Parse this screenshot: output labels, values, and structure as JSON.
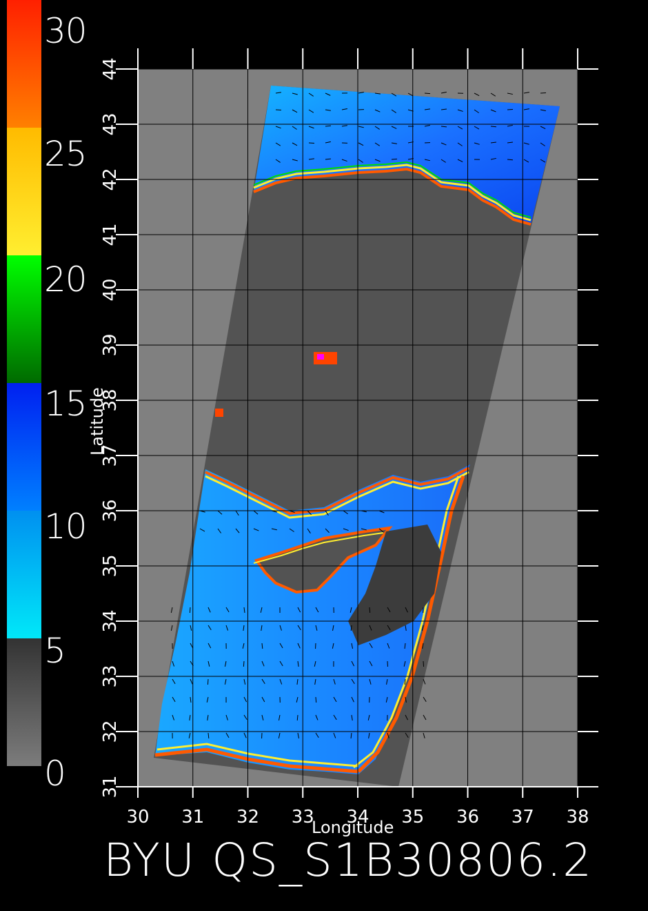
{
  "title": "BYU  QS_S1B30806.2",
  "colorbar": {
    "labels": [
      "30",
      "25",
      "20",
      "15",
      "10",
      "5",
      "0"
    ],
    "segments": [
      {
        "from": 0,
        "to": 5,
        "colors": [
          "#7c7c7c",
          "#333333"
        ]
      },
      {
        "from": 5,
        "to": 10,
        "colors": [
          "#00e8f8",
          "#0090f0"
        ]
      },
      {
        "from": 10,
        "to": 15,
        "colors": [
          "#0080ff",
          "#0020f0"
        ]
      },
      {
        "from": 15,
        "to": 20,
        "colors": [
          "#006a00",
          "#00ff00"
        ]
      },
      {
        "from": 20,
        "to": 25,
        "colors": [
          "#ffee30",
          "#ffbb00"
        ]
      },
      {
        "from": 25,
        "to": 30,
        "colors": [
          "#ff8000",
          "#ff2000"
        ]
      }
    ]
  },
  "axes": {
    "xlabel": "Longitude",
    "ylabel": "Latitude",
    "xticks": [
      "30",
      "31",
      "32",
      "33",
      "34",
      "35",
      "36",
      "37",
      "38"
    ],
    "yticks": [
      "31",
      "32",
      "33",
      "34",
      "35",
      "36",
      "37",
      "38",
      "39",
      "40",
      "41",
      "42",
      "43",
      "44"
    ],
    "xlim": [
      30,
      38
    ],
    "ylim": [
      31,
      44
    ]
  },
  "colors": {
    "background": "#000000",
    "land": "#535353",
    "outside_swath": "#808080",
    "ocean_low": "#1a90ff",
    "ocean_high": "#0a4cf0",
    "grid": "#000000"
  }
}
